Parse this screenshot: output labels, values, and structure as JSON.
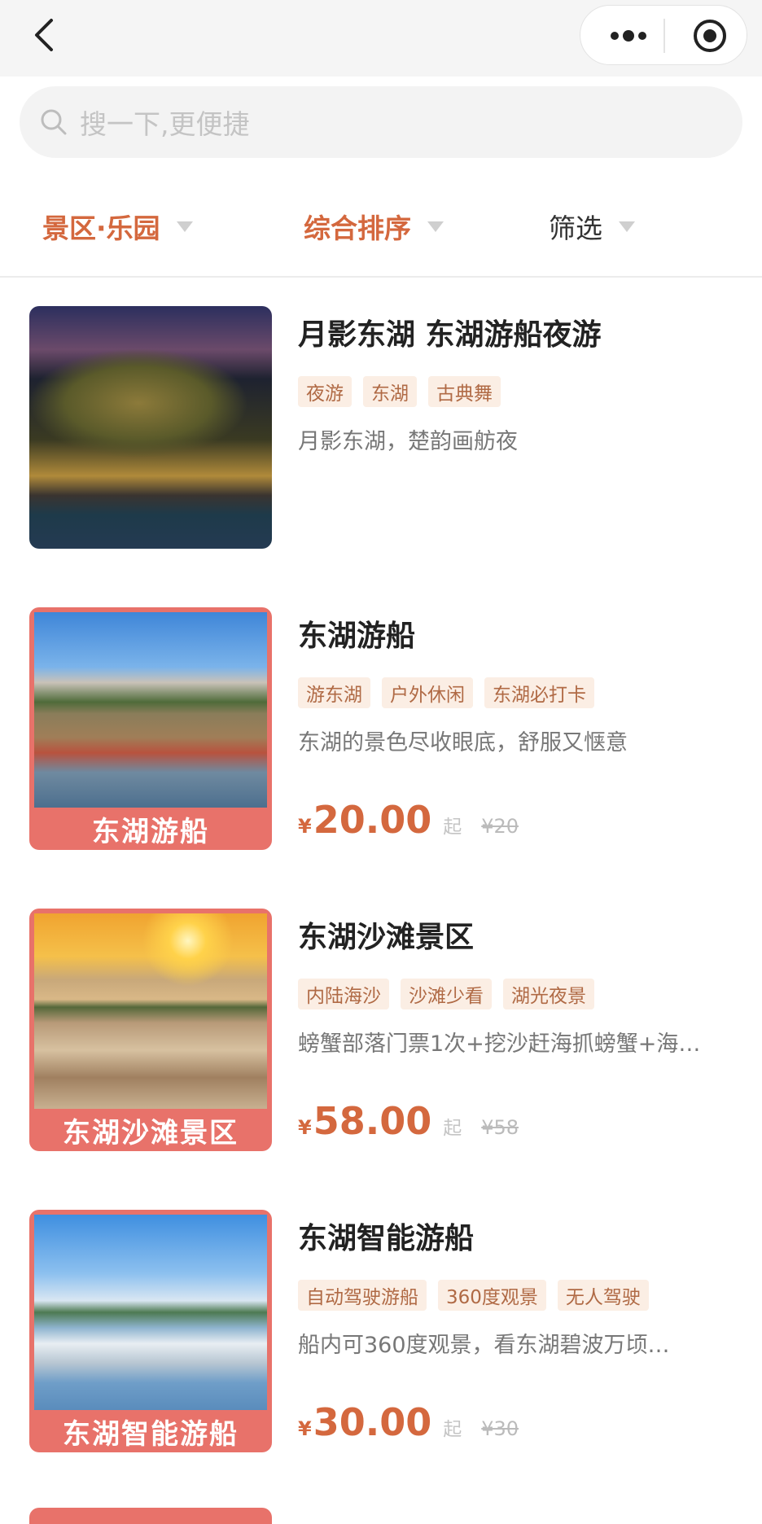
{
  "header": {
    "back_icon": "chevron-left-icon",
    "more_icon": "more-dots-icon",
    "target_icon": "target-icon"
  },
  "search": {
    "placeholder": "搜一下,更便捷",
    "icon": "search-icon"
  },
  "filters": [
    {
      "label": "景区·乐园"
    },
    {
      "label": "综合排序"
    },
    {
      "label": "筛选"
    }
  ],
  "colors": {
    "accent": "#d4683e",
    "tag_bg": "#fbeee4",
    "tag_text": "#b06a45",
    "frame": "#e8726a"
  },
  "items": [
    {
      "title": "月影东湖 东湖游船夜游",
      "tags": [
        "夜游",
        "东湖",
        "古典舞"
      ],
      "desc": "月影东湖，楚韵画舫夜",
      "caption": "",
      "price_symbol": "",
      "price": "",
      "from": "",
      "original": ""
    },
    {
      "title": "东湖游船",
      "tags": [
        "游东湖",
        "户外休闲",
        "东湖必打卡"
      ],
      "desc": "东湖的景色尽收眼底，舒服又惬意",
      "caption": "东湖游船",
      "price_symbol": "¥",
      "price": "20.00",
      "from": "起",
      "original": "¥20"
    },
    {
      "title": "东湖沙滩景区",
      "tags": [
        "内陆海沙",
        "沙滩少看",
        "湖光夜景"
      ],
      "desc": "螃蟹部落门票1次+挖沙赶海抓螃蟹+海…",
      "caption": "东湖沙滩景区",
      "price_symbol": "¥",
      "price": "58.00",
      "from": "起",
      "original": "¥58"
    },
    {
      "title": "东湖智能游船",
      "tags": [
        "自动驾驶游船",
        "360度观景",
        "无人驾驶"
      ],
      "desc": "船内可360度观景，看东湖碧波万顷…",
      "caption": "东湖智能游船",
      "price_symbol": "¥",
      "price": "30.00",
      "from": "起",
      "original": "¥30"
    }
  ]
}
